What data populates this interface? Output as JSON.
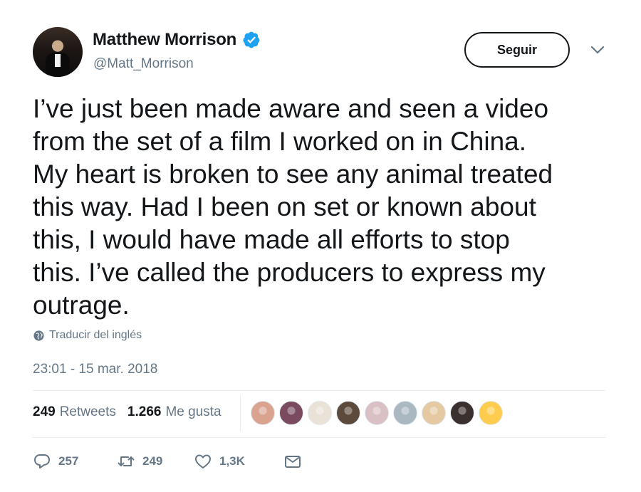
{
  "author": {
    "display_name": "Matthew Morrison",
    "handle": "@Matt_Morrison",
    "verified": true
  },
  "follow_button": {
    "label": "Seguir"
  },
  "tweet": {
    "lines": [
      "I’ve just been made aware and seen a video",
      "from the set of a film I worked on in China.",
      "My heart is broken to see any animal treated",
      "this way.  Had I been on set or known about",
      "this, I would have made all efforts to stop",
      "this.  I’ve called the producers to express my",
      "outrage."
    ]
  },
  "translate": {
    "label": "Traducir del inglés",
    "icon": "globe-icon"
  },
  "timestamp": "23:01 - 15 mar. 2018",
  "stats": {
    "retweets": {
      "count": "249",
      "label": "Retweets"
    },
    "likes": {
      "count": "1.266",
      "label": "Me gusta"
    }
  },
  "liker_avatars": [
    {
      "color": "#d9a38f"
    },
    {
      "color": "#7a4a5e"
    },
    {
      "color": "#e9e2d6"
    },
    {
      "color": "#5c4a3c"
    },
    {
      "color": "#d8c0c4"
    },
    {
      "color": "#aab8c2"
    },
    {
      "color": "#e4c9a2"
    },
    {
      "color": "#3a3030"
    },
    {
      "color": "#ffcc4d"
    }
  ],
  "actions": {
    "replies": "257",
    "retweets": "249",
    "likes": "1,3K"
  },
  "colors": {
    "accent": "#1da1f2",
    "secondary_text": "#657786",
    "primary_text": "#14171a",
    "divider": "#e6ecf0"
  }
}
